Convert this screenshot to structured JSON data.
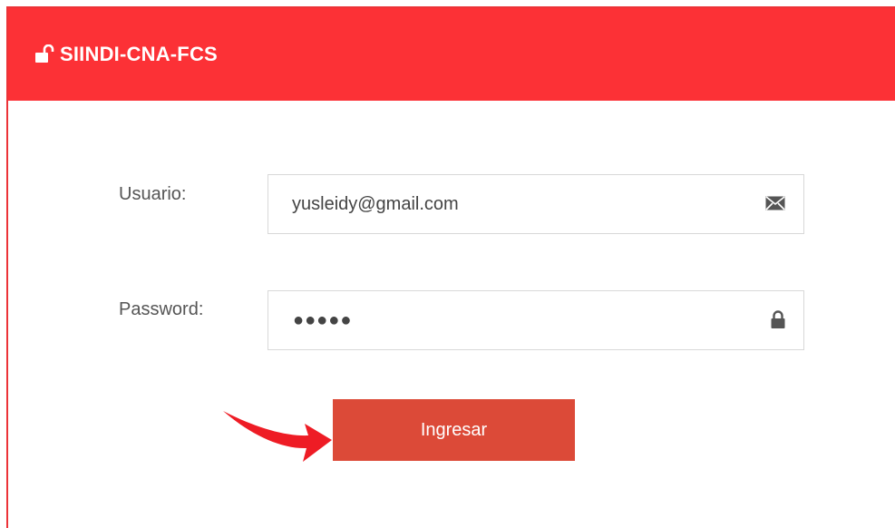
{
  "header": {
    "title": "SIINDI-CNA-FCS",
    "icon": "unlocked-lock-icon",
    "color": "#fc3136"
  },
  "form": {
    "username": {
      "label": "Usuario:",
      "value": "yusleidy@gmail.com",
      "icon": "envelope-icon"
    },
    "password": {
      "label": "Password:",
      "masked_value": "●●●●●",
      "icon": "lock-icon"
    },
    "submit": {
      "label": "Ingresar",
      "color": "#dc4a38"
    }
  },
  "annotation": {
    "icon": "red-arrow-icon",
    "color": "#ee1c25"
  }
}
